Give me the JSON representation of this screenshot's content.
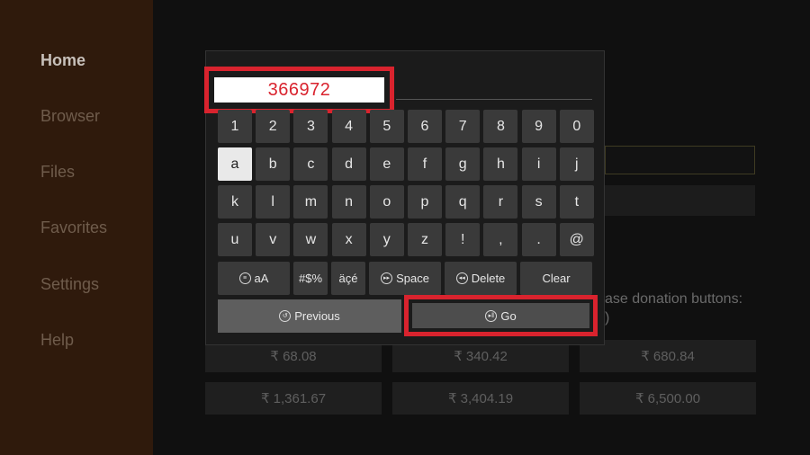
{
  "sidebar": {
    "items": [
      {
        "label": "Home",
        "active": true
      },
      {
        "label": "Browser",
        "active": false
      },
      {
        "label": "Files",
        "active": false
      },
      {
        "label": "Favorites",
        "active": false
      },
      {
        "label": "Settings",
        "active": false
      },
      {
        "label": "Help",
        "active": false
      }
    ]
  },
  "background": {
    "donation_text_line1": "ase donation buttons:",
    "donation_text_line2": ")",
    "donation_buttons": [
      "₹ 68.08",
      "₹ 340.42",
      "₹ 680.84",
      "₹ 1,361.67",
      "₹ 3,404.19",
      "₹ 6,500.00"
    ]
  },
  "keyboard": {
    "input_value": "366972",
    "rows": [
      [
        "1",
        "2",
        "3",
        "4",
        "5",
        "6",
        "7",
        "8",
        "9",
        "0"
      ],
      [
        "a",
        "b",
        "c",
        "d",
        "e",
        "f",
        "g",
        "h",
        "i",
        "j"
      ],
      [
        "k",
        "l",
        "m",
        "n",
        "o",
        "p",
        "q",
        "r",
        "s",
        "t"
      ],
      [
        "u",
        "v",
        "w",
        "x",
        "y",
        "z",
        "!",
        ",",
        ".",
        "@"
      ]
    ],
    "selected_key": "a",
    "func_keys": {
      "case": "aA",
      "symbols": "#$%",
      "accents": "äçé",
      "space": "Space",
      "delete": "Delete",
      "clear": "Clear"
    },
    "previous_label": "Previous",
    "go_label": "Go"
  },
  "colors": {
    "highlight": "#d9232e",
    "sidebar_bg": "#2f1a0c",
    "key_bg": "#3a3a3a",
    "key_selected_bg": "#e9e9e9"
  },
  "icons": {
    "case": "menu-icon",
    "space": "fast-forward-icon",
    "delete": "rewind-icon",
    "previous": "replay-icon",
    "go": "play-pause-icon"
  }
}
